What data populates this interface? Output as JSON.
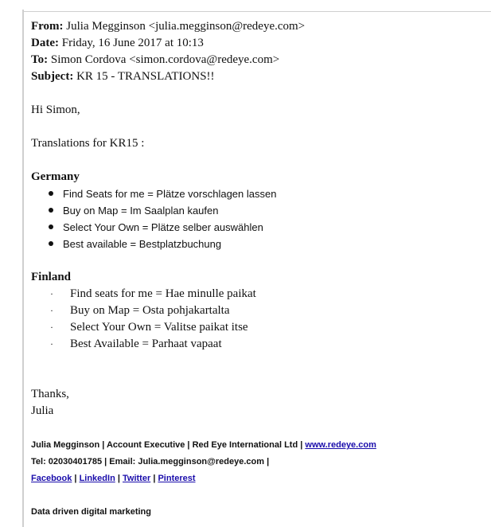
{
  "headers": {
    "from_label": "From:",
    "from_value": "Julia Megginson <julia.megginson@redeye.com>",
    "date_label": "Date:",
    "date_value": "Friday, 16 June 2017 at 10:13",
    "to_label": "To:",
    "to_value": "Simon Cordova <simon.cordova@redeye.com>",
    "subject_label": "Subject:",
    "subject_value": "KR 15 - TRANSLATIONS!!"
  },
  "body": {
    "greeting": "Hi Simon,",
    "intro": "Translations for KR15 :",
    "germany": {
      "title": "Germany",
      "items": [
        "Find Seats for me = Plätze vorschlagen lassen",
        "Buy on Map = Im Saalplan kaufen",
        "Select Your Own = Plätze selber auswählen",
        "Best available = Bestplatzbuchung"
      ]
    },
    "finland": {
      "title": "Finland",
      "bullet": "·",
      "items": [
        "Find seats for me = Hae minulle paikat",
        "Buy on Map = Osta pohjakartalta",
        "Select Your Own = Valitse paikat itse",
        "Best Available = Parhaat vapaat"
      ]
    },
    "thanks": "Thanks,",
    "name": "Julia"
  },
  "signature": {
    "line1_text": "Julia Megginson | Account Executive | Red Eye International Ltd | ",
    "website_link": "www.redeye.com",
    "line2_text": "Tel: 02030401785 | Email: Julia.megginson@redeye.com |",
    "facebook": "Facebook",
    "linkedin": "LinkedIn",
    "twitter": "Twitter",
    "pinterest": "Pinterest",
    "separator": "|",
    "tagline": "Data driven digital marketing"
  }
}
